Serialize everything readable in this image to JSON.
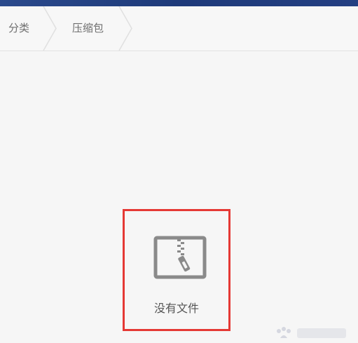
{
  "breadcrumb": {
    "items": [
      {
        "label": "分类"
      },
      {
        "label": "压缩包"
      }
    ]
  },
  "empty_state": {
    "icon": "zip-archive-icon",
    "message": "没有文件"
  },
  "colors": {
    "status_bar": "#1e3a7a",
    "highlight_border": "#e53935",
    "icon_gray": "#8a8a8a",
    "text_gray": "#555555",
    "background": "#f6f6f6"
  }
}
